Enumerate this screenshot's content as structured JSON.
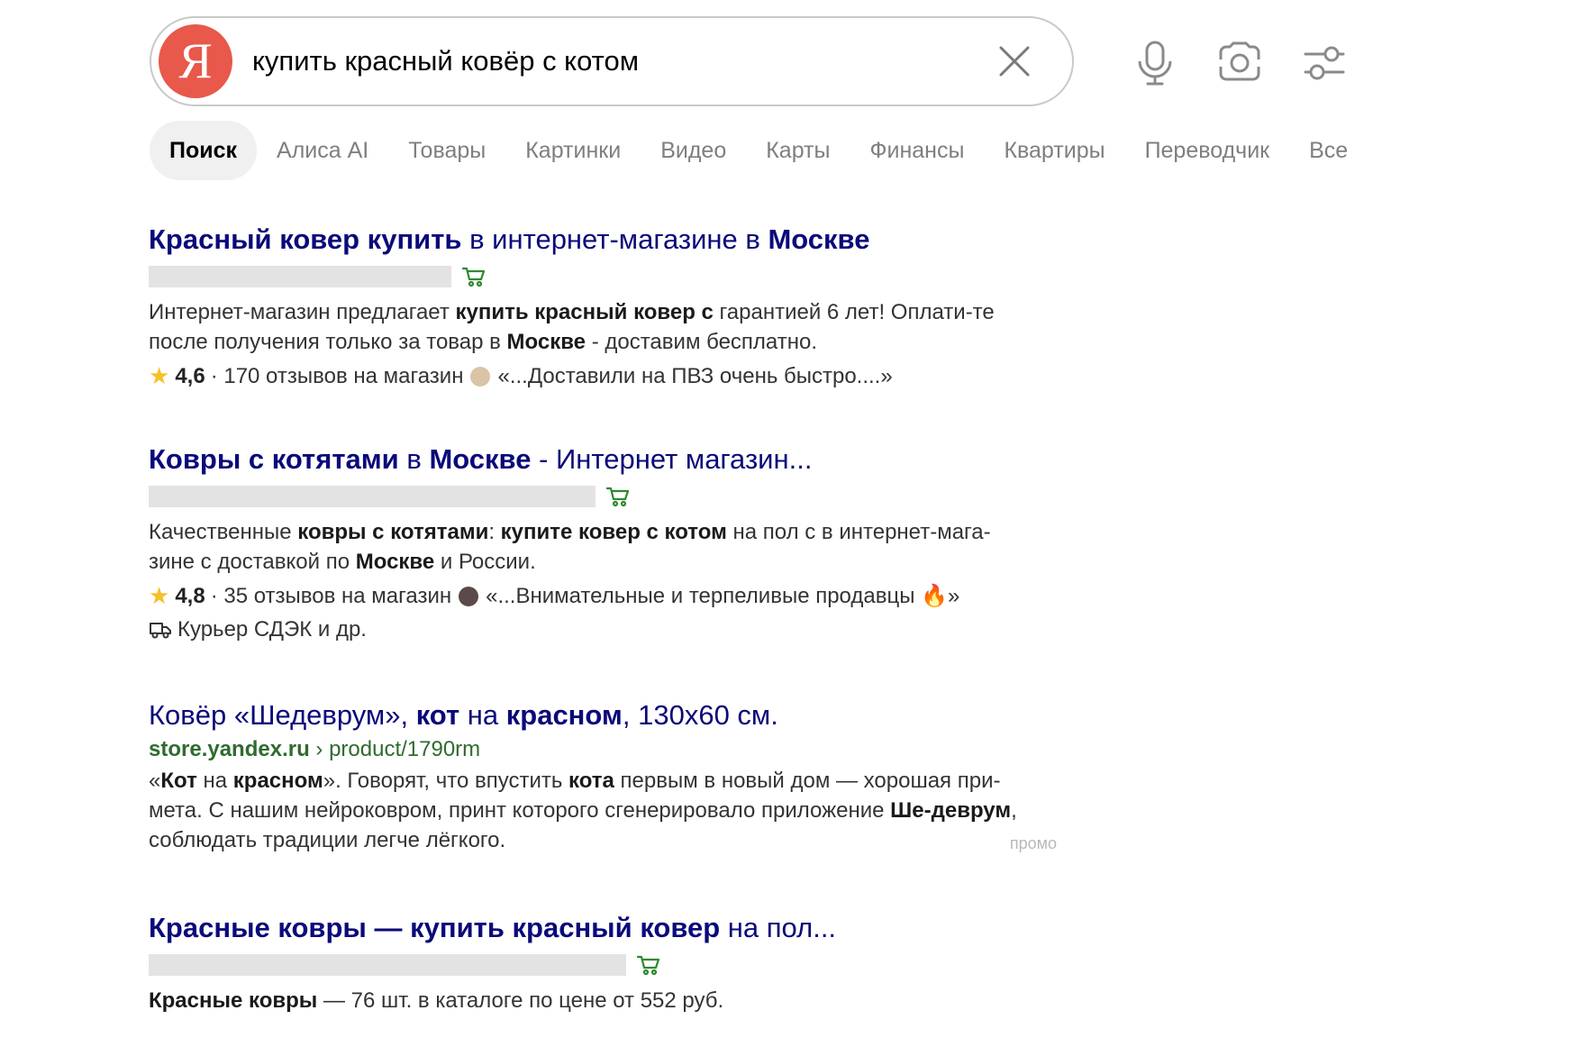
{
  "search": {
    "logo_letter": "Я",
    "query": "купить красный ковёр с котом"
  },
  "toolbar": {
    "mic": "microphone-icon",
    "camera": "camera-icon",
    "filters": "filters-icon"
  },
  "tabs": [
    {
      "label": "Поиск",
      "active": true
    },
    {
      "label": "Алиса AI",
      "active": false
    },
    {
      "label": "Товары",
      "active": false
    },
    {
      "label": "Картинки",
      "active": false
    },
    {
      "label": "Видео",
      "active": false
    },
    {
      "label": "Карты",
      "active": false
    },
    {
      "label": "Финансы",
      "active": false
    },
    {
      "label": "Квартиры",
      "active": false
    },
    {
      "label": "Переводчик",
      "active": false
    },
    {
      "label": "Все",
      "active": false
    }
  ],
  "results": [
    {
      "title_parts": [
        {
          "text": "Красный ковер купить",
          "bold": true
        },
        {
          "text": " в интернет-магазине в ",
          "bold": false
        },
        {
          "text": "Москве",
          "bold": true
        }
      ],
      "snippet_parts": [
        {
          "text": "Интернет-магазин предлагает ",
          "bold": false
        },
        {
          "text": "купить красный ковер с",
          "bold": true
        },
        {
          "text": " гарантией 6 лет! Оплати-те после получения только за товар в ",
          "bold": false
        },
        {
          "text": "Москве",
          "bold": true
        },
        {
          "text": " - доставим бесплатно.",
          "bold": false
        }
      ],
      "rating": {
        "score": "4,6",
        "reviews": "· 170 отзывов на магазин",
        "quote": "«...Доставили на ПВЗ очень быстро....»"
      }
    },
    {
      "title_parts": [
        {
          "text": "Ковры с котятами",
          "bold": true
        },
        {
          "text": " в ",
          "bold": false
        },
        {
          "text": "Москве",
          "bold": true
        },
        {
          "text": " - Интернет магазин...",
          "bold": false
        }
      ],
      "snippet_parts": [
        {
          "text": "Качественные ",
          "bold": false
        },
        {
          "text": "ковры с котятами",
          "bold": true
        },
        {
          "text": ": ",
          "bold": false
        },
        {
          "text": "купите ковер с котом",
          "bold": true
        },
        {
          "text": " на пол с в интернет-мага-зине с доставкой по ",
          "bold": false
        },
        {
          "text": "Москве",
          "bold": true
        },
        {
          "text": " и России.",
          "bold": false
        }
      ],
      "rating": {
        "score": "4,8",
        "reviews": "· 35 отзывов на магазин",
        "quote": "«...Внимательные и терпеливые продавцы 🔥»"
      },
      "delivery": "Курьер СДЭК и др."
    },
    {
      "title_parts": [
        {
          "text": "Ковёр «Шедеврум», ",
          "bold": false
        },
        {
          "text": "кот",
          "bold": true
        },
        {
          "text": " на ",
          "bold": false
        },
        {
          "text": "красном",
          "bold": true
        },
        {
          "text": ", 130х60 см.",
          "bold": false
        }
      ],
      "url_domain": "store.yandex.ru",
      "url_path": " › product/1790rm",
      "snippet_parts": [
        {
          "text": "«",
          "bold": false
        },
        {
          "text": "Кот",
          "bold": true
        },
        {
          "text": " на ",
          "bold": false
        },
        {
          "text": "красном",
          "bold": true
        },
        {
          "text": "». Говорят, что впустить ",
          "bold": false
        },
        {
          "text": "кота",
          "bold": true
        },
        {
          "text": " первым в новый дом — хорошая при-мета. С нашим нейроковром, принт которого сгенерировало приложение ",
          "bold": false
        },
        {
          "text": "Ше-деврум",
          "bold": true
        },
        {
          "text": ", соблюдать традиции легче лёгкого.",
          "bold": false
        }
      ],
      "promo": "промо"
    },
    {
      "title_parts": [
        {
          "text": "Красные ковры — купить красный ковер",
          "bold": true
        },
        {
          "text": " на пол...",
          "bold": false
        }
      ],
      "snippet_parts": [
        {
          "text": "Красные ковры",
          "bold": true
        },
        {
          "text": " — 76 шт. в каталоге по цене от 552 руб.",
          "bold": false
        }
      ]
    }
  ],
  "colors": {
    "logo_red": "#e8584b",
    "title_blue": "#0a0a7a",
    "url_green": "#2f6b2f",
    "star_yellow": "#f6c026"
  }
}
